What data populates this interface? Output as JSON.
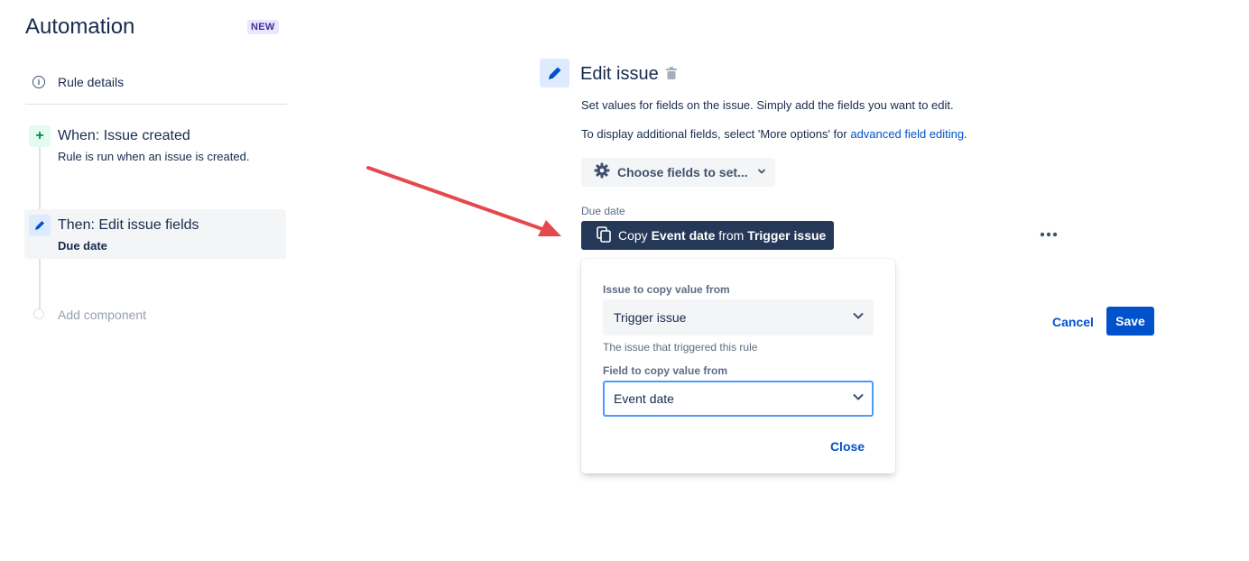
{
  "app": {
    "title": "Automation",
    "badge": "NEW"
  },
  "sidebar": {
    "rule_details": "Rule details",
    "trigger": {
      "title": "When: Issue created",
      "description": "Rule is run when an issue is created."
    },
    "action": {
      "title": "Then: Edit issue fields",
      "subtitle": "Due date"
    },
    "add_component": "Add component"
  },
  "main": {
    "title": "Edit issue",
    "description": "Set values for fields on the issue. Simply add the fields you want to edit.",
    "more_options_prefix": "To display additional fields, select 'More options' for ",
    "more_options_link": "advanced field editing",
    "more_options_suffix": ".",
    "choose_fields_button": "Choose fields to set...",
    "field_label": "Due date",
    "copy_button": {
      "prefix": "Copy ",
      "field": "Event date",
      "middle": " from ",
      "source": "Trigger issue"
    },
    "cancel_label": "Cancel",
    "save_label": "Save"
  },
  "popup": {
    "issue_label": "Issue to copy value from",
    "issue_value": "Trigger issue",
    "issue_help": "The issue that triggered this rule",
    "field_label": "Field to copy value from",
    "field_value": "Event date",
    "close_label": "Close"
  },
  "colors": {
    "primary": "#0052cc",
    "dark_button": "#253858",
    "focus_border": "#4c9aff",
    "annotation_arrow": "#e5484d"
  }
}
